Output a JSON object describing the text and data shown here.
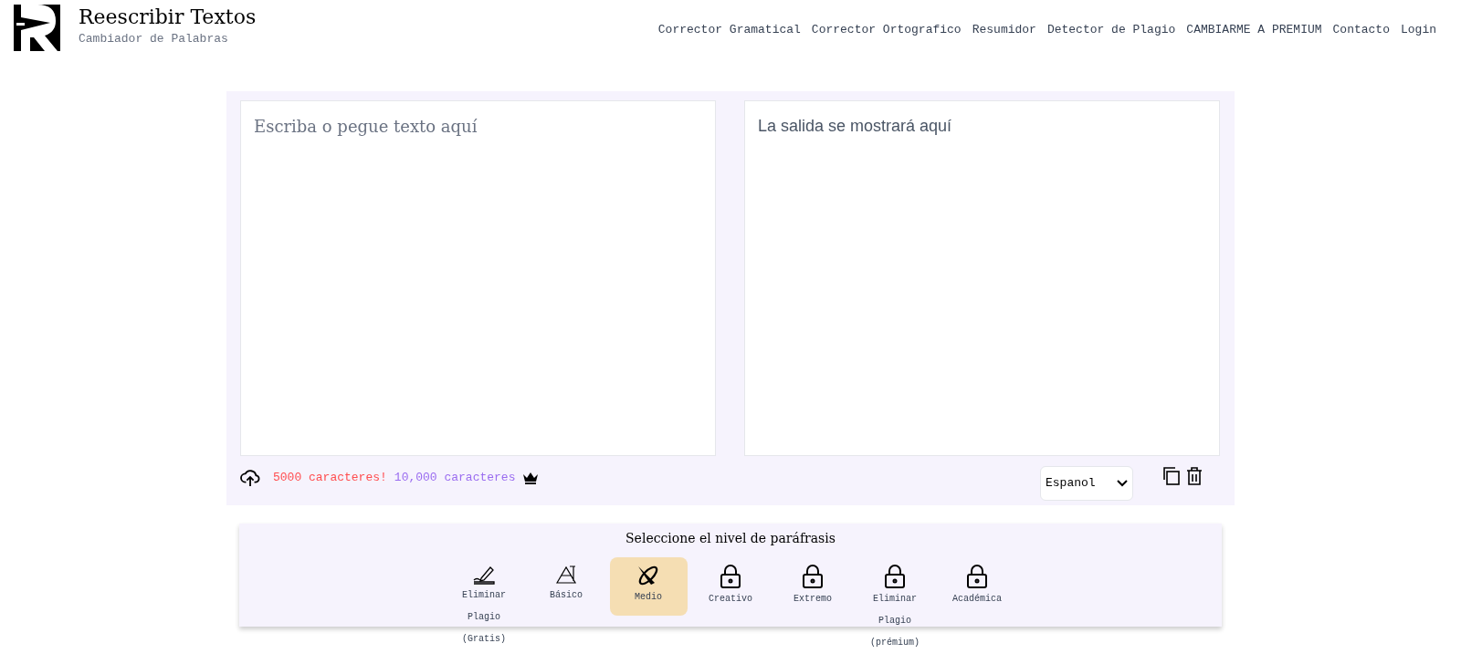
{
  "brand": {
    "title": "Reescribir Textos",
    "subtitle": "Cambiador de Palabras"
  },
  "nav": [
    "Corrector Gramatical",
    "Corrector Ortografico",
    "Resumidor",
    "Detector de Plagio",
    "CAMBIARME A PREMIUM",
    "Contacto",
    "Login"
  ],
  "input": {
    "placeholder": "Escriba o pegue texto aquí"
  },
  "output": {
    "placeholder": "La salida se mostrará aquí"
  },
  "limits": {
    "free": "5000 caracteres!",
    "premium": "10,000 caracteres"
  },
  "language": {
    "value": "Espanol"
  },
  "levels": {
    "title": "Seleccione el nivel de paráfrasis",
    "modes": [
      {
        "label": "Eliminar Plagio (Gratis)",
        "kind": "pen",
        "selected": false
      },
      {
        "label": "Básico",
        "kind": "triangle",
        "selected": false
      },
      {
        "label": "Medio",
        "kind": "medium",
        "selected": true
      },
      {
        "label": "Creativo",
        "kind": "lock",
        "selected": false
      },
      {
        "label": "Extremo",
        "kind": "lock",
        "selected": false
      },
      {
        "label": "Eliminar Plagio (prémium)",
        "kind": "lock",
        "selected": false
      },
      {
        "label": "Académica",
        "kind": "lock",
        "selected": false
      }
    ]
  }
}
